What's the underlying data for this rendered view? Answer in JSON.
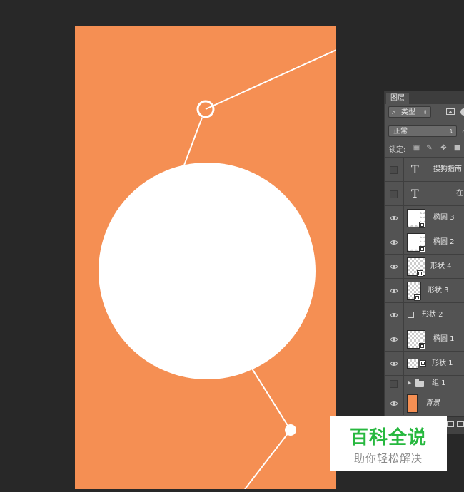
{
  "layers_panel": {
    "tab_label": "图层",
    "filter": {
      "value": "类型",
      "search_icon": "search-icon"
    },
    "blend_mode": "正常",
    "lock_label": "锁定:",
    "layers": [
      {
        "name": "搜狗指南",
        "kind": "text",
        "visible": false
      },
      {
        "name": "在",
        "kind": "text",
        "visible": false
      },
      {
        "name": "椭圆 3",
        "kind": "ellipse",
        "visible": true
      },
      {
        "name": "椭圆 2",
        "kind": "ellipse",
        "visible": true
      },
      {
        "name": "形状 4",
        "kind": "shape",
        "visible": true
      },
      {
        "name": "形状 3",
        "kind": "shape",
        "visible": true
      },
      {
        "name": "形状 2",
        "kind": "shape",
        "visible": true
      },
      {
        "name": "椭圆 1",
        "kind": "ellipse",
        "visible": true
      },
      {
        "name": "形状 1",
        "kind": "shape",
        "visible": true
      },
      {
        "name": "组 1",
        "kind": "group",
        "visible": false
      },
      {
        "name": "背景",
        "kind": "background",
        "visible": true
      }
    ]
  },
  "canvas": {
    "background_color": "#f58f53",
    "shape_color": "#ffffff"
  },
  "watermark": {
    "title": "百科全说",
    "subtitle": "助你轻松解决",
    "title_color": "#27b83f"
  }
}
